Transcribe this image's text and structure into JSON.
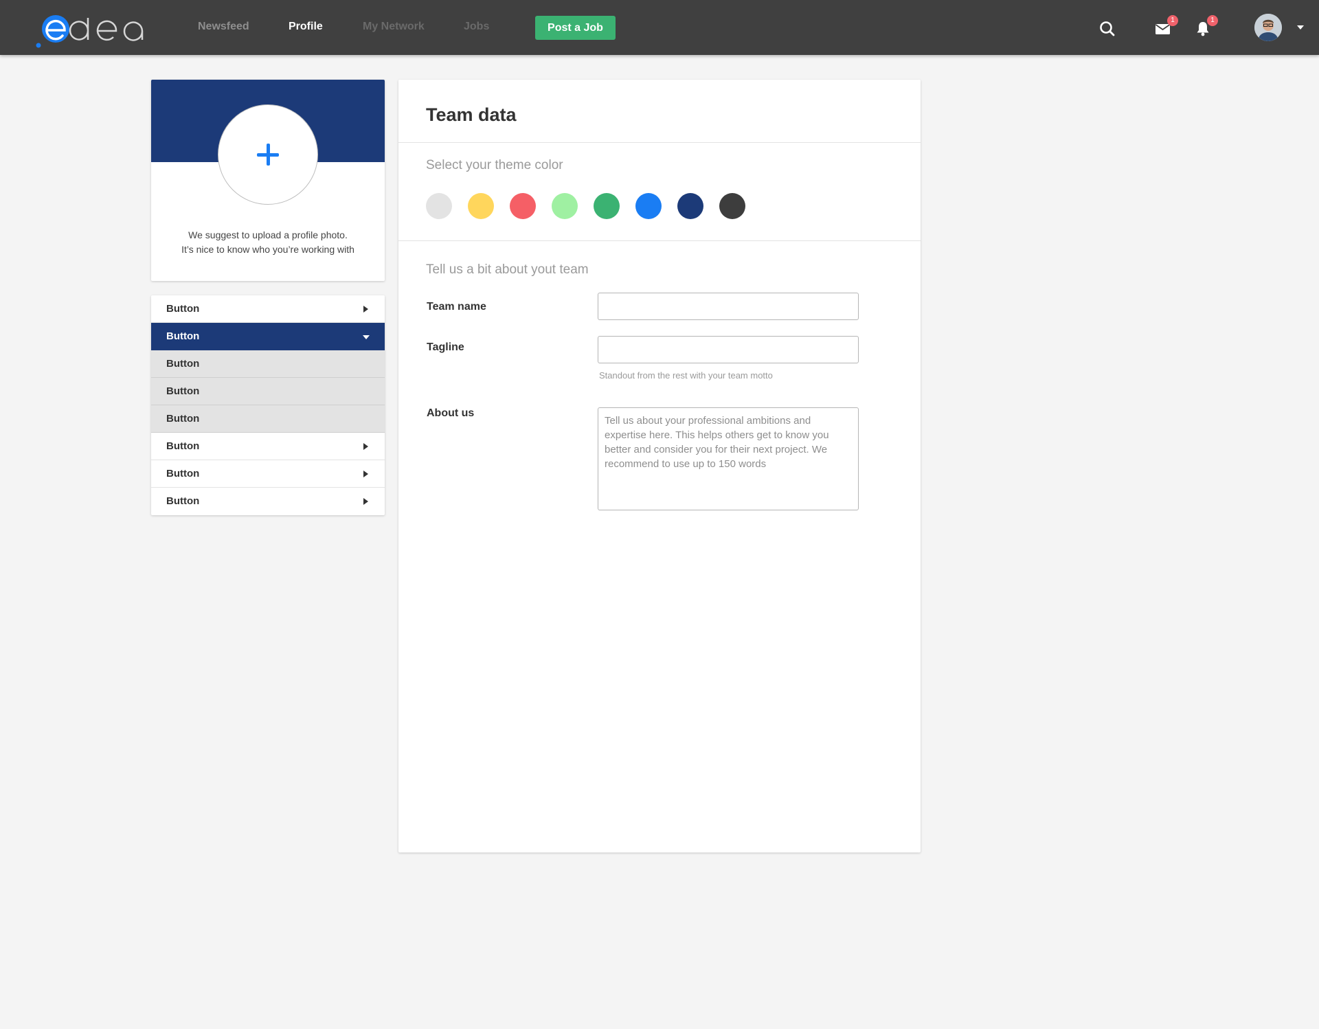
{
  "nav": {
    "links": [
      {
        "label": "Newsfeed"
      },
      {
        "label": "Profile"
      },
      {
        "label": "My Network"
      },
      {
        "label": "Jobs"
      }
    ],
    "post_job_label": "Post a Job",
    "mail_badge": "1",
    "notifications_badge": "1"
  },
  "profile_card": {
    "suggest_line1": "We suggest to upload a profile photo.",
    "suggest_line2": "It’s nice to know who you’re working with"
  },
  "menu": {
    "items": [
      {
        "label": "Button",
        "state": "collapsed"
      },
      {
        "label": "Button",
        "state": "expanded"
      },
      {
        "label": "Button",
        "state": "sub"
      },
      {
        "label": "Button",
        "state": "sub"
      },
      {
        "label": "Button",
        "state": "sub"
      },
      {
        "label": "Button",
        "state": "collapsed"
      },
      {
        "label": "Button",
        "state": "collapsed"
      },
      {
        "label": "Button",
        "state": "collapsed"
      }
    ]
  },
  "panel": {
    "title": "Team data",
    "theme_label": "Select your theme color",
    "theme_colors": [
      "#e3e3e3",
      "#ffd65c",
      "#f55f66",
      "#9ff0a2",
      "#3bb272",
      "#1a7df3",
      "#1c3a78",
      "#3d3d3d"
    ],
    "about_section_label": "Tell us a bit about yout team",
    "team_name_label": "Team name",
    "team_name_value": "",
    "tagline_label": "Tagline",
    "tagline_value": "",
    "tagline_hint": "Standout from the rest with your team motto",
    "about_label": "About us",
    "about_placeholder": "Tell us about your professional ambitions and expertise here. This helps others get to know you better and consider you for their next project. We recommend to use up to 150 words"
  },
  "colors": {
    "topbar": "#404040",
    "accent_blue": "#1a7df3",
    "navy": "#1c3a78",
    "green": "#3bb272",
    "badge": "#f0626b"
  }
}
